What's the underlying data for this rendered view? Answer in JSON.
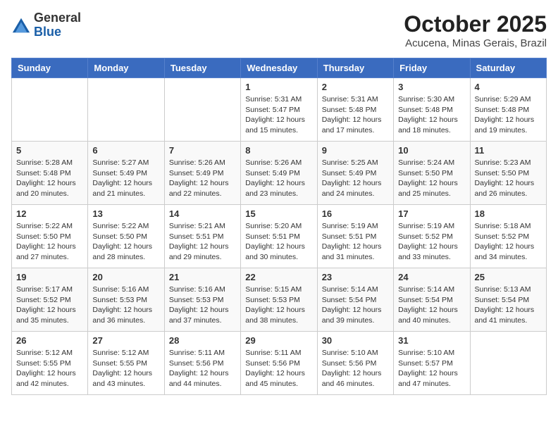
{
  "logo": {
    "general": "General",
    "blue": "Blue"
  },
  "header": {
    "month": "October 2025",
    "location": "Acucena, Minas Gerais, Brazil"
  },
  "days_of_week": [
    "Sunday",
    "Monday",
    "Tuesday",
    "Wednesday",
    "Thursday",
    "Friday",
    "Saturday"
  ],
  "weeks": [
    [
      {
        "day": "",
        "info": ""
      },
      {
        "day": "",
        "info": ""
      },
      {
        "day": "",
        "info": ""
      },
      {
        "day": "1",
        "info": "Sunrise: 5:31 AM\nSunset: 5:47 PM\nDaylight: 12 hours and 15 minutes."
      },
      {
        "day": "2",
        "info": "Sunrise: 5:31 AM\nSunset: 5:48 PM\nDaylight: 12 hours and 17 minutes."
      },
      {
        "day": "3",
        "info": "Sunrise: 5:30 AM\nSunset: 5:48 PM\nDaylight: 12 hours and 18 minutes."
      },
      {
        "day": "4",
        "info": "Sunrise: 5:29 AM\nSunset: 5:48 PM\nDaylight: 12 hours and 19 minutes."
      }
    ],
    [
      {
        "day": "5",
        "info": "Sunrise: 5:28 AM\nSunset: 5:48 PM\nDaylight: 12 hours and 20 minutes."
      },
      {
        "day": "6",
        "info": "Sunrise: 5:27 AM\nSunset: 5:49 PM\nDaylight: 12 hours and 21 minutes."
      },
      {
        "day": "7",
        "info": "Sunrise: 5:26 AM\nSunset: 5:49 PM\nDaylight: 12 hours and 22 minutes."
      },
      {
        "day": "8",
        "info": "Sunrise: 5:26 AM\nSunset: 5:49 PM\nDaylight: 12 hours and 23 minutes."
      },
      {
        "day": "9",
        "info": "Sunrise: 5:25 AM\nSunset: 5:49 PM\nDaylight: 12 hours and 24 minutes."
      },
      {
        "day": "10",
        "info": "Sunrise: 5:24 AM\nSunset: 5:50 PM\nDaylight: 12 hours and 25 minutes."
      },
      {
        "day": "11",
        "info": "Sunrise: 5:23 AM\nSunset: 5:50 PM\nDaylight: 12 hours and 26 minutes."
      }
    ],
    [
      {
        "day": "12",
        "info": "Sunrise: 5:22 AM\nSunset: 5:50 PM\nDaylight: 12 hours and 27 minutes."
      },
      {
        "day": "13",
        "info": "Sunrise: 5:22 AM\nSunset: 5:50 PM\nDaylight: 12 hours and 28 minutes."
      },
      {
        "day": "14",
        "info": "Sunrise: 5:21 AM\nSunset: 5:51 PM\nDaylight: 12 hours and 29 minutes."
      },
      {
        "day": "15",
        "info": "Sunrise: 5:20 AM\nSunset: 5:51 PM\nDaylight: 12 hours and 30 minutes."
      },
      {
        "day": "16",
        "info": "Sunrise: 5:19 AM\nSunset: 5:51 PM\nDaylight: 12 hours and 31 minutes."
      },
      {
        "day": "17",
        "info": "Sunrise: 5:19 AM\nSunset: 5:52 PM\nDaylight: 12 hours and 33 minutes."
      },
      {
        "day": "18",
        "info": "Sunrise: 5:18 AM\nSunset: 5:52 PM\nDaylight: 12 hours and 34 minutes."
      }
    ],
    [
      {
        "day": "19",
        "info": "Sunrise: 5:17 AM\nSunset: 5:52 PM\nDaylight: 12 hours and 35 minutes."
      },
      {
        "day": "20",
        "info": "Sunrise: 5:16 AM\nSunset: 5:53 PM\nDaylight: 12 hours and 36 minutes."
      },
      {
        "day": "21",
        "info": "Sunrise: 5:16 AM\nSunset: 5:53 PM\nDaylight: 12 hours and 37 minutes."
      },
      {
        "day": "22",
        "info": "Sunrise: 5:15 AM\nSunset: 5:53 PM\nDaylight: 12 hours and 38 minutes."
      },
      {
        "day": "23",
        "info": "Sunrise: 5:14 AM\nSunset: 5:54 PM\nDaylight: 12 hours and 39 minutes."
      },
      {
        "day": "24",
        "info": "Sunrise: 5:14 AM\nSunset: 5:54 PM\nDaylight: 12 hours and 40 minutes."
      },
      {
        "day": "25",
        "info": "Sunrise: 5:13 AM\nSunset: 5:54 PM\nDaylight: 12 hours and 41 minutes."
      }
    ],
    [
      {
        "day": "26",
        "info": "Sunrise: 5:12 AM\nSunset: 5:55 PM\nDaylight: 12 hours and 42 minutes."
      },
      {
        "day": "27",
        "info": "Sunrise: 5:12 AM\nSunset: 5:55 PM\nDaylight: 12 hours and 43 minutes."
      },
      {
        "day": "28",
        "info": "Sunrise: 5:11 AM\nSunset: 5:56 PM\nDaylight: 12 hours and 44 minutes."
      },
      {
        "day": "29",
        "info": "Sunrise: 5:11 AM\nSunset: 5:56 PM\nDaylight: 12 hours and 45 minutes."
      },
      {
        "day": "30",
        "info": "Sunrise: 5:10 AM\nSunset: 5:56 PM\nDaylight: 12 hours and 46 minutes."
      },
      {
        "day": "31",
        "info": "Sunrise: 5:10 AM\nSunset: 5:57 PM\nDaylight: 12 hours and 47 minutes."
      },
      {
        "day": "",
        "info": ""
      }
    ]
  ]
}
